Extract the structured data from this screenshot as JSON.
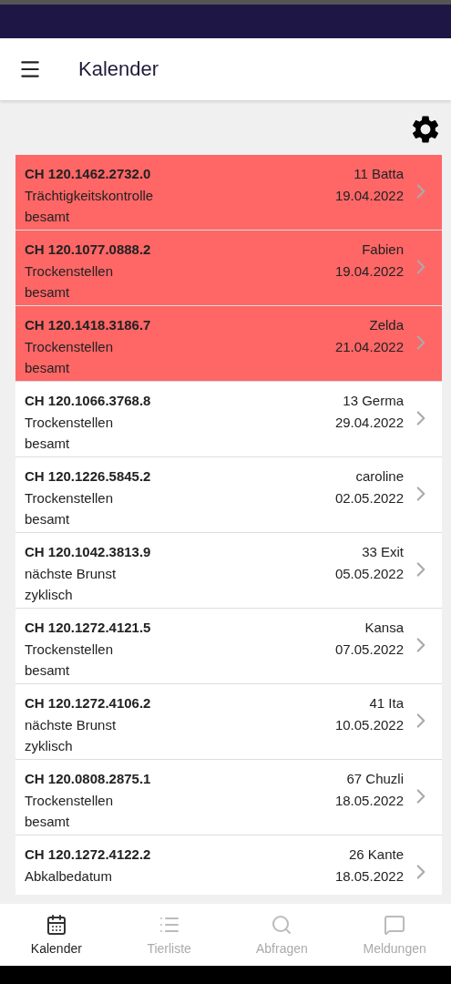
{
  "header": {
    "title": "Kalender"
  },
  "entries": [
    {
      "id": "CH 120.1462.2732.0",
      "event": "Trächtigkeitskontrolle",
      "status": "besamt",
      "name": "11 Batta",
      "date": "19.04.2022",
      "highlighted": true
    },
    {
      "id": "CH 120.1077.0888.2",
      "event": "Trockenstellen",
      "status": "besamt",
      "name": "Fabien",
      "date": "19.04.2022",
      "highlighted": true
    },
    {
      "id": "CH 120.1418.3186.7",
      "event": "Trockenstellen",
      "status": "besamt",
      "name": "Zelda",
      "date": "21.04.2022",
      "highlighted": true
    },
    {
      "id": "CH 120.1066.3768.8",
      "event": "Trockenstellen",
      "status": "besamt",
      "name": "13 Germa",
      "date": "29.04.2022",
      "highlighted": false
    },
    {
      "id": "CH 120.1226.5845.2",
      "event": "Trockenstellen",
      "status": "besamt",
      "name": "caroline",
      "date": "02.05.2022",
      "highlighted": false
    },
    {
      "id": "CH 120.1042.3813.9",
      "event": "nächste Brunst",
      "status": "zyklisch",
      "name": "33 Exit",
      "date": "05.05.2022",
      "highlighted": false
    },
    {
      "id": "CH 120.1272.4121.5",
      "event": "Trockenstellen",
      "status": "besamt",
      "name": "Kansa",
      "date": "07.05.2022",
      "highlighted": false
    },
    {
      "id": "CH 120.1272.4106.2",
      "event": "nächste Brunst",
      "status": "zyklisch",
      "name": "41 Ita",
      "date": "10.05.2022",
      "highlighted": false
    },
    {
      "id": "CH 120.0808.2875.1",
      "event": "Trockenstellen",
      "status": "besamt",
      "name": "67 Chuzli",
      "date": "18.05.2022",
      "highlighted": false
    },
    {
      "id": "CH 120.1272.4122.2",
      "event": "Abkalbedatum",
      "name": "26 Kante",
      "date": "18.05.2022",
      "highlighted": false
    }
  ],
  "nav": [
    {
      "label": "Kalender",
      "kind": "calendar",
      "selected": true
    },
    {
      "label": "Tierliste",
      "kind": "list",
      "selected": false
    },
    {
      "label": "Abfragen",
      "kind": "search",
      "selected": false
    },
    {
      "label": "Meldungen",
      "kind": "messages",
      "selected": false
    }
  ]
}
